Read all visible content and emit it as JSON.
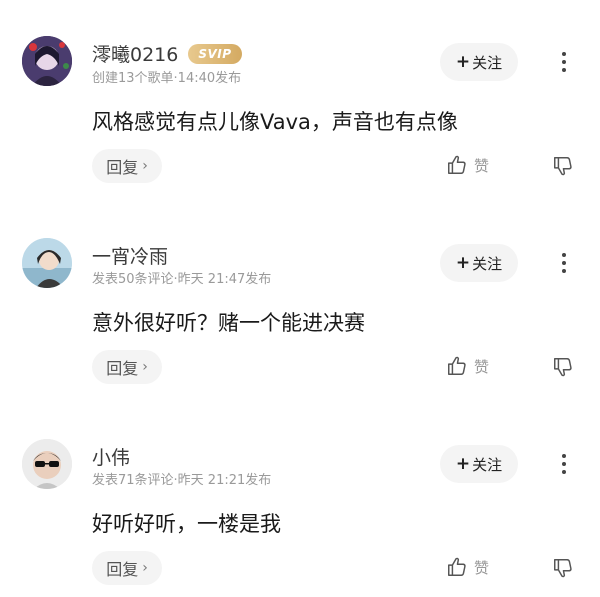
{
  "comments": [
    {
      "username": "澪曦0216",
      "badge": "SVIP",
      "meta": "创建13个歌单·14:40发布",
      "follow_label": "关注",
      "text": "风格感觉有点儿像Vava，声音也有点像",
      "reply_label": "回复",
      "like_label": "赞"
    },
    {
      "username": "一宵冷雨",
      "meta": "发表50条评论·昨天 21:47发布",
      "follow_label": "关注",
      "text": "意外很好听？赌一个能进决赛",
      "reply_label": "回复",
      "like_label": "赞"
    },
    {
      "username": "小伟",
      "meta": "发表71条评论·昨天 21:21发布",
      "follow_label": "关注",
      "text": "好听好听，一楼是我",
      "reply_label": "回复",
      "like_label": "赞"
    }
  ],
  "icons": {
    "plus": "+",
    "chevron": "›"
  },
  "colors": {
    "svip_gold": "#d4aa62",
    "muted_text": "#9a9a9a",
    "pill_bg": "#f4f4f4"
  }
}
